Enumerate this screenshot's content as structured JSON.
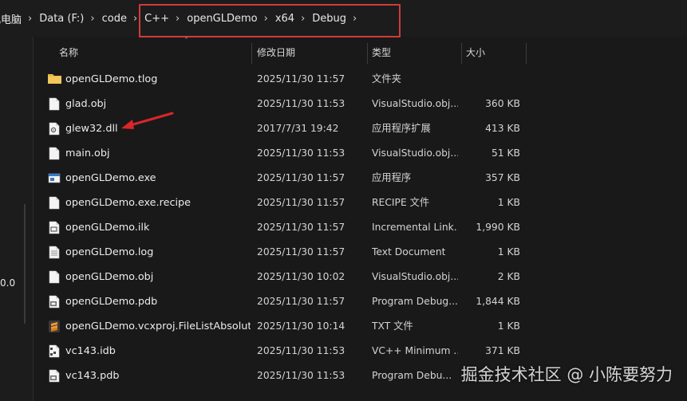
{
  "breadcrumb": {
    "items": [
      "此电脑",
      "Data (F:)",
      "code",
      "C++",
      "openGLDemo",
      "x64",
      "Debug"
    ],
    "separator": "›"
  },
  "nav_pane": {
    "partial_text": "0.0"
  },
  "columns": {
    "name": "名称",
    "date": "修改日期",
    "type": "类型",
    "size": "大小"
  },
  "files": [
    {
      "name": "openGLDemo.tlog",
      "date": "2025/11/30 11:57",
      "type": "文件夹",
      "size": "",
      "icon": "folder-icon"
    },
    {
      "name": "glad.obj",
      "date": "2025/11/30 11:53",
      "type": "VisualStudio.obj....",
      "size": "360 KB",
      "icon": "file-icon"
    },
    {
      "name": "glew32.dll",
      "date": "2017/7/31 19:42",
      "type": "应用程序扩展",
      "size": "413 KB",
      "icon": "dll-icon"
    },
    {
      "name": "main.obj",
      "date": "2025/11/30 11:53",
      "type": "VisualStudio.obj....",
      "size": "51 KB",
      "icon": "file-icon"
    },
    {
      "name": "openGLDemo.exe",
      "date": "2025/11/30 11:57",
      "type": "应用程序",
      "size": "357 KB",
      "icon": "exe-icon"
    },
    {
      "name": "openGLDemo.exe.recipe",
      "date": "2025/11/30 11:57",
      "type": "RECIPE 文件",
      "size": "1 KB",
      "icon": "file-icon"
    },
    {
      "name": "openGLDemo.ilk",
      "date": "2025/11/30 11:57",
      "type": "Incremental Link...",
      "size": "1,990 KB",
      "icon": "ilk-icon"
    },
    {
      "name": "openGLDemo.log",
      "date": "2025/11/30 11:57",
      "type": "Text Document",
      "size": "1 KB",
      "icon": "text-file-icon"
    },
    {
      "name": "openGLDemo.obj",
      "date": "2025/11/30 10:02",
      "type": "VisualStudio.obj....",
      "size": "2 KB",
      "icon": "file-icon"
    },
    {
      "name": "openGLDemo.pdb",
      "date": "2025/11/30 11:57",
      "type": "Program Debug...",
      "size": "1,844 KB",
      "icon": "pdb-icon"
    },
    {
      "name": "openGLDemo.vcxproj.FileListAbsolute....",
      "date": "2025/11/30 10:14",
      "type": "TXT 文件",
      "size": "1 KB",
      "icon": "sublime-icon"
    },
    {
      "name": "vc143.idb",
      "date": "2025/11/30 11:53",
      "type": "VC++ Minimum ...",
      "size": "371 KB",
      "icon": "idb-icon"
    },
    {
      "name": "vc143.pdb",
      "date": "2025/11/30 11:53",
      "type": "Program Debu...",
      "size": "",
      "icon": "pdb-icon"
    }
  ],
  "watermark": "掘金技术社区 @ 小陈要努力",
  "colors": {
    "highlight_box": "#d23a3a",
    "annotation_arrow": "#d8262b",
    "folder": "#e8b84a",
    "background": "#191919"
  }
}
